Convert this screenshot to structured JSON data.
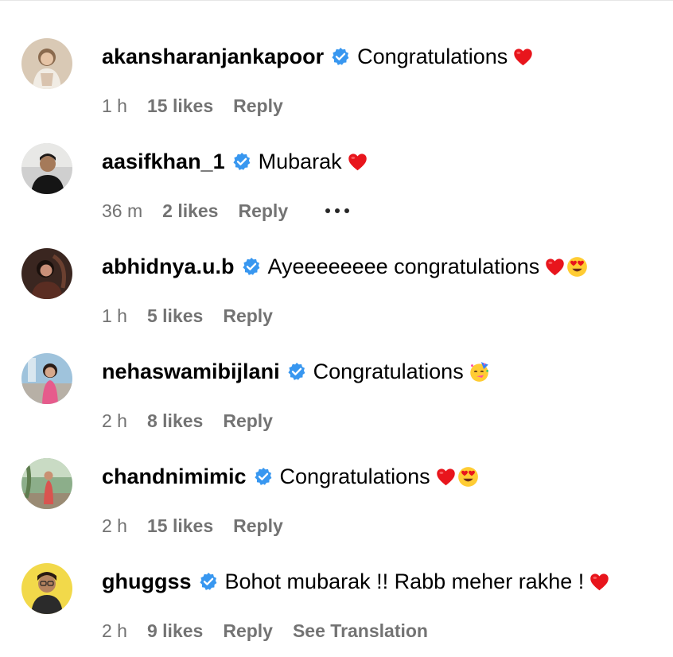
{
  "colors": {
    "verified": "#3897f0",
    "meta_text": "#737373",
    "heart": "#e8151c"
  },
  "comments": [
    {
      "username": "akansharanjankapoor",
      "text": "Congratulations",
      "emojis": [
        "heart-emoji"
      ],
      "time": "1 h",
      "likes": "15 likes",
      "reply": "Reply",
      "avatar": "avatar-akansharanjankapoor"
    },
    {
      "username": "aasifkhan_1",
      "text": "Mubarak",
      "emojis": [
        "heart-emoji"
      ],
      "time": "36 m",
      "likes": "2 likes",
      "reply": "Reply",
      "more_icon": "ellipsis-icon",
      "avatar": "avatar-aasifkhan_1"
    },
    {
      "username": "abhidnya.u.b",
      "text": "Ayeeeeeeee congratulations",
      "emojis": [
        "heart-emoji",
        "heart-eyes-emoji"
      ],
      "time": "1 h",
      "likes": "5 likes",
      "reply": "Reply",
      "avatar": "avatar-abhidnya"
    },
    {
      "username": "nehaswamibijlani",
      "text": "Congratulations",
      "emojis": [
        "party-face-emoji"
      ],
      "time": "2 h",
      "likes": "8 likes",
      "reply": "Reply",
      "avatar": "avatar-nehaswamibijlani"
    },
    {
      "username": "chandnimimic",
      "text": "Congratulations",
      "emojis": [
        "heart-emoji",
        "heart-eyes-emoji"
      ],
      "time": "2 h",
      "likes": "15 likes",
      "reply": "Reply",
      "avatar": "avatar-chandnimimic"
    },
    {
      "username": "ghuggss",
      "text": "Bohot mubarak !! Rabb meher rakhe !",
      "emojis": [
        "heart-emoji"
      ],
      "time": "2 h",
      "likes": "9 likes",
      "reply": "Reply",
      "see_translation": "See Translation",
      "avatar": "avatar-ghuggss"
    }
  ]
}
